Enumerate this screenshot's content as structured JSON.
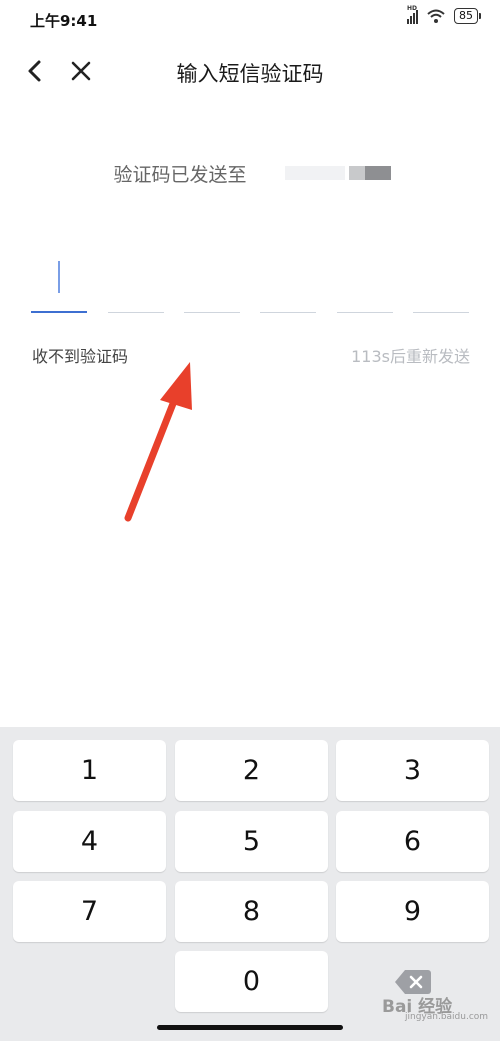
{
  "status_bar": {
    "time": "上午9:41",
    "battery": "85",
    "signal_badge": "HD"
  },
  "nav": {
    "title": "输入短信验证码"
  },
  "sent_to": {
    "label": "验证码已发送至"
  },
  "code": {
    "length": 6,
    "active_index": 0
  },
  "links": {
    "no_code": "收不到验证码",
    "resend_countdown": "113s后重新发送"
  },
  "keyboard": {
    "keys": [
      "1",
      "2",
      "3",
      "4",
      "5",
      "6",
      "7",
      "8",
      "9",
      "0"
    ],
    "delete_icon": "backspace-icon"
  },
  "watermark": {
    "text": "Bai 经验",
    "sub": "jingyan.baidu.com"
  },
  "colors": {
    "accent": "#3d6fd1",
    "arrow": "#e8402b",
    "keyboard_bg": "#e9eaec"
  }
}
